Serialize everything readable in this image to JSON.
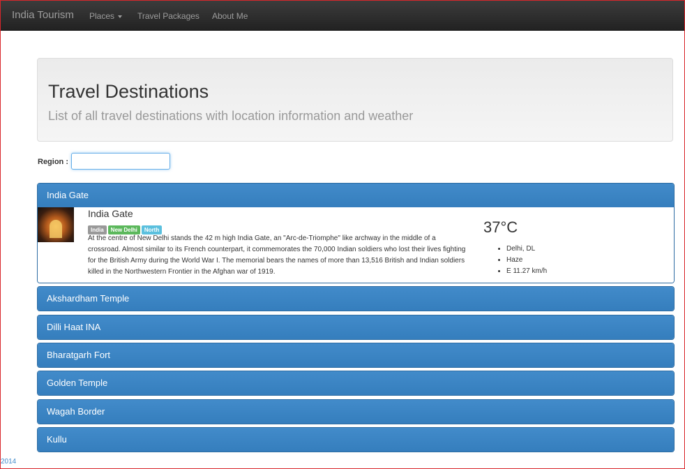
{
  "navbar": {
    "brand": "India Tourism",
    "items": [
      {
        "label": "Places",
        "has_dropdown": true
      },
      {
        "label": "Travel Packages"
      },
      {
        "label": "About Me"
      }
    ]
  },
  "header": {
    "title": "Travel Destinations",
    "subtitle": "List of all travel destinations with location information and weather"
  },
  "filter": {
    "label": "Region :",
    "value": ""
  },
  "destinations": [
    {
      "name": "India Gate",
      "expanded": true,
      "title": "India Gate",
      "tags": [
        "India",
        "New Delhi",
        "North"
      ],
      "description": "At the centre of New Delhi stands the 42 m high India Gate, an \"Arc-de-Triomphe\" like archway in the middle of a crossroad. Almost similar to its French counterpart, it commemorates the 70,000 Indian soldiers who lost their lives fighting for the British Army during the World War I. The memorial bears the names of more than 13,516 British and Indian soldiers killed in the Northwestern Frontier in the Afghan war of 1919.",
      "weather": {
        "temperature": "37°C",
        "details": [
          "Delhi, DL",
          "Haze",
          "E 11.27 km/h"
        ]
      }
    },
    {
      "name": "Akshardham Temple"
    },
    {
      "name": "Dilli Haat INA"
    },
    {
      "name": "Bharatgarh Fort"
    },
    {
      "name": "Golden Temple"
    },
    {
      "name": "Wagah Border"
    },
    {
      "name": "Kullu"
    }
  ],
  "footer": {
    "text": "2014"
  },
  "colors": {
    "navbar": "#222222",
    "panel_primary": "#428bca",
    "tag_gray": "#999999",
    "tag_green": "#5cb85c",
    "tag_cyan": "#5bc0de"
  }
}
